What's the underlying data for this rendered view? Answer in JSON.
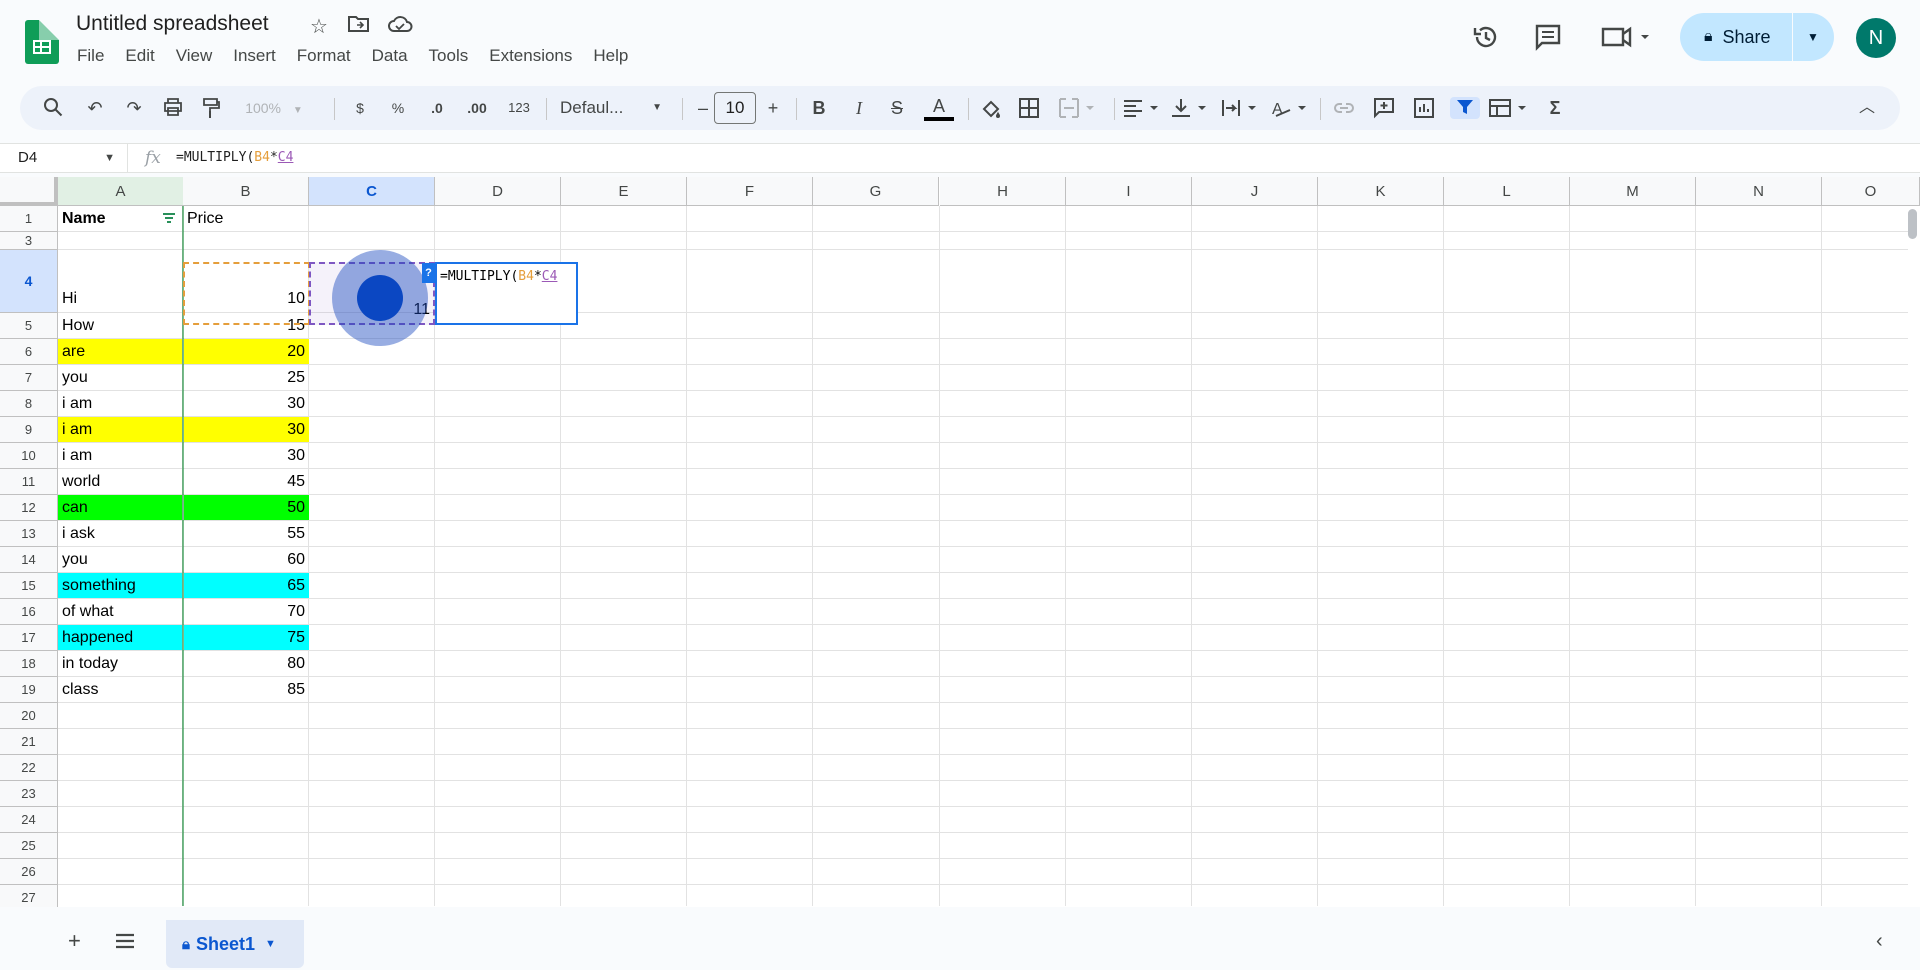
{
  "app": {
    "doc_title": "Untitled spreadsheet",
    "menu": [
      "File",
      "Edit",
      "View",
      "Insert",
      "Format",
      "Data",
      "Tools",
      "Extensions",
      "Help"
    ],
    "share_label": "Share",
    "avatar_initial": "N"
  },
  "toolbar": {
    "zoom": "100%",
    "currency": "$",
    "percent": "%",
    "dec_decrease": ".0",
    "dec_increase": ".00",
    "number_format": "123",
    "font": "Defaul...",
    "font_size": "10",
    "minus": "–",
    "plus": "+",
    "bold": "B",
    "italic": "I",
    "strike": "S",
    "text_color": "A",
    "sigma": "Σ"
  },
  "formula_bar": {
    "name_box": "D4",
    "fx": "fx",
    "formula_prefix": "=MULTIPLY(",
    "formula_ref1": "B4",
    "formula_op": "*",
    "formula_ref2": "C4"
  },
  "grid": {
    "columns": [
      "A",
      "B",
      "C",
      "D",
      "E",
      "F",
      "G",
      "H",
      "I",
      "J",
      "K",
      "L",
      "M",
      "N",
      "O"
    ],
    "row_numbers": [
      "1",
      "3",
      "4",
      "5",
      "6",
      "7",
      "8",
      "9",
      "10",
      "11",
      "12",
      "13",
      "14",
      "15",
      "16",
      "17",
      "18",
      "19",
      "20",
      "21",
      "22",
      "23",
      "24",
      "25",
      "26",
      "27"
    ],
    "header": {
      "a": "Name",
      "b": "Price"
    },
    "rows": [
      {
        "row": "4",
        "name": "Hi",
        "price": "10",
        "fill": ""
      },
      {
        "row": "5",
        "name": "How",
        "price": "15",
        "fill": ""
      },
      {
        "row": "6",
        "name": "are",
        "price": "20",
        "fill": "#ffff00"
      },
      {
        "row": "7",
        "name": "you",
        "price": "25",
        "fill": ""
      },
      {
        "row": "8",
        "name": "i am",
        "price": "30",
        "fill": ""
      },
      {
        "row": "9",
        "name": "i am",
        "price": "30",
        "fill": "#ffff00"
      },
      {
        "row": "10",
        "name": "i am",
        "price": "30",
        "fill": ""
      },
      {
        "row": "11",
        "name": "world",
        "price": "45",
        "fill": ""
      },
      {
        "row": "12",
        "name": "can",
        "price": "50",
        "fill": "#00ff00"
      },
      {
        "row": "13",
        "name": "i ask",
        "price": "55",
        "fill": ""
      },
      {
        "row": "14",
        "name": "you",
        "price": "60",
        "fill": ""
      },
      {
        "row": "15",
        "name": "something",
        "price": "65",
        "fill": "#00ffff"
      },
      {
        "row": "16",
        "name": "of what",
        "price": "70",
        "fill": ""
      },
      {
        "row": "17",
        "name": "happened",
        "price": "75",
        "fill": "#00ffff"
      },
      {
        "row": "18",
        "name": "in today",
        "price": "80",
        "fill": ""
      },
      {
        "row": "19",
        "name": "class",
        "price": "85",
        "fill": ""
      }
    ],
    "c4_value": "11",
    "editor_help": "?"
  },
  "bottom": {
    "add_sheet": "+",
    "sheet_name": "Sheet1"
  }
}
